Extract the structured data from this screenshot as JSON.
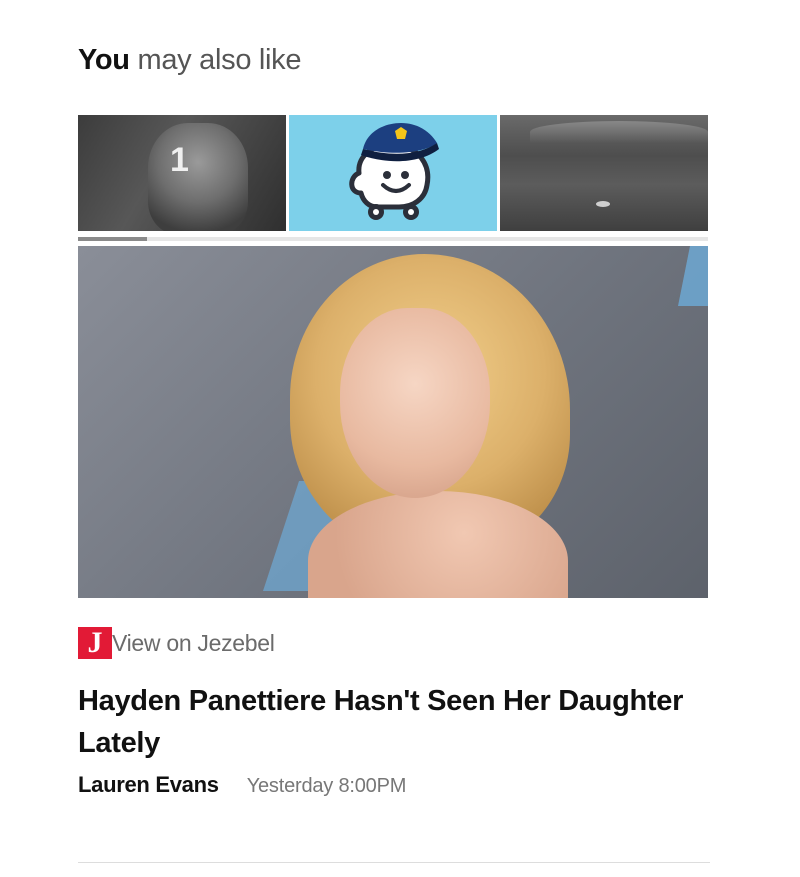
{
  "section": {
    "title_strong": "You",
    "title_light": "may also like"
  },
  "carousel": {
    "thumbnails": [
      {
        "badge": "1",
        "icon": "photo-thumbnail"
      },
      {
        "icon": "waze-police-mascot-icon"
      },
      {
        "icon": "lunar-surface-photo"
      }
    ],
    "progress_fraction": 0.11,
    "progress_color": "#8a8a8a"
  },
  "article": {
    "source_logo_letter": "J",
    "source_logo_color": "#e21a36",
    "source_label": "View on Jezebel",
    "headline": "Hayden Panettiere Hasn't Seen Her Daughter Lately",
    "author": "Lauren Evans",
    "timestamp": "Yesterday 8:00PM"
  }
}
